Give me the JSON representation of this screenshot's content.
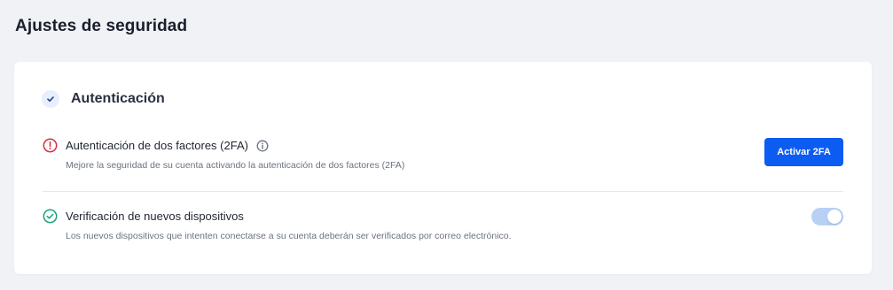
{
  "page": {
    "title": "Ajustes de seguridad"
  },
  "section": {
    "title": "Autenticación",
    "icon": "checkmark-icon"
  },
  "two_factor": {
    "title": "Autenticación de dos factores (2FA)",
    "description": "Mejore la seguridad de su cuenta activando la autenticación de dos factores (2FA)",
    "status_icon": "warning-circle-icon",
    "info_icon": "info-icon",
    "button_label": "Activar 2FA",
    "status_color": "#d92d45"
  },
  "device_verification": {
    "title": "Verificación de nuevos dispositivos",
    "description": "Los nuevos dispositivos que intenten conectarse a su cuenta deberán ser verificados por correo electrónico.",
    "status_icon": "check-circle-icon",
    "toggle_on": true,
    "status_color": "#1aa37a"
  },
  "colors": {
    "accent": "#0d5cf2",
    "toggle_track": "#b8d0f4",
    "background": "#f0f2f6"
  }
}
